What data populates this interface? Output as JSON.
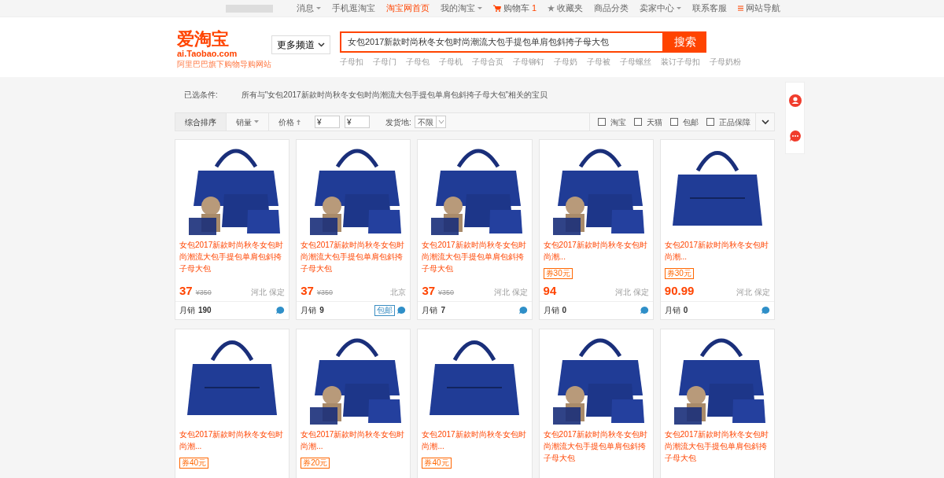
{
  "top_nav": {
    "items": [
      {
        "label": "消息",
        "kind": "dropdown"
      },
      {
        "label": "手机逛淘宝",
        "kind": "plain"
      },
      {
        "label": "淘宝网首页",
        "kind": "highlight"
      },
      {
        "label": "我的淘宝",
        "kind": "dropdown"
      },
      {
        "label": "购物车",
        "kind": "cart",
        "count": "1"
      },
      {
        "label": "收藏夹",
        "kind": "star"
      },
      {
        "label": "商品分类",
        "kind": "plain"
      },
      {
        "label": "卖家中心",
        "kind": "dropdown"
      },
      {
        "label": "联系客服",
        "kind": "plain"
      },
      {
        "label": "网站导航",
        "kind": "menu"
      }
    ]
  },
  "logo": {
    "title": "爱淘宝",
    "domain": "ai.Taobao.com",
    "tagline": "阿里巴巴旗下购物导购网站"
  },
  "channel_button": "更多频道",
  "search": {
    "value": "女包2017新款时尚秋冬女包时尚潮流大包手提包单肩包斜挎子母大包",
    "button": "搜索"
  },
  "suggestions": [
    "子母扣",
    "子母门",
    "子母包",
    "子母机",
    "子母合页",
    "子母铆钉",
    "子母奶",
    "子母被",
    "子母螺丝",
    "装订子母扣",
    "子母奶粉"
  ],
  "conditions": {
    "label": "已选条件:",
    "text": "所有与\"女包2017新款时尚秋冬女包时尚潮流大包手提包单肩包斜挎子母大包\"相关的宝贝"
  },
  "sort_tabs": [
    {
      "label": "综合排序",
      "selected": true
    },
    {
      "label": "销量",
      "selected": false
    },
    {
      "label": "价格",
      "selected": false
    }
  ],
  "price_from": {
    "placeholder": "¥"
  },
  "price_to": {
    "placeholder": "¥"
  },
  "ship_from": {
    "label": "发货地:",
    "value": "不限"
  },
  "filters": [
    {
      "label": "淘宝",
      "checked": false
    },
    {
      "label": "天猫",
      "checked": false
    },
    {
      "label": "包邮",
      "checked": false
    },
    {
      "label": "正品保障",
      "checked": false
    }
  ],
  "products": [
    {
      "kind": "set",
      "title": "女包2017新款时尚秋冬女包时尚潮流大包手提包单肩包斜挎子母大包",
      "price": "37",
      "original_price": "¥350",
      "location": "河北 保定",
      "sales_label": "月销",
      "sales": "190"
    },
    {
      "kind": "set",
      "title": "女包2017新款时尚秋冬女包时尚潮流大包手提包单肩包斜挎子母大包",
      "price": "37",
      "original_price": "¥350",
      "location": "北京",
      "sales_label": "月销",
      "sales": "9",
      "tag": "包邮"
    },
    {
      "kind": "set",
      "title": "女包2017新款时尚秋冬女包时尚潮流大包手提包单肩包斜挎子母大包",
      "price": "37",
      "original_price": "¥350",
      "location": "河北 保定",
      "sales_label": "月销",
      "sales": "7"
    },
    {
      "kind": "set",
      "title": "女包2017新款时尚秋冬女包时尚潮...",
      "coupon": "券30元",
      "price": "94",
      "location": "河北 保定",
      "sales_label": "月销",
      "sales": "0"
    },
    {
      "kind": "single",
      "title": "女包2017新款时尚秋冬女包时尚潮...",
      "coupon": "券30元",
      "price": "90.99",
      "location": "河北 保定",
      "sales_label": "月销",
      "sales": "0"
    },
    {
      "kind": "single",
      "title": "女包2017新款时尚秋冬女包时尚潮...",
      "coupon": "券40元"
    },
    {
      "kind": "set",
      "title": "女包2017新款时尚秋冬女包时尚潮...",
      "coupon": "券20元"
    },
    {
      "kind": "single",
      "title": "女包2017新款时尚秋冬女包时尚潮...",
      "coupon": "券40元"
    },
    {
      "kind": "set",
      "title": "女包2017新款时尚秋冬女包时尚潮流大包手提包单肩包斜挎子母大包"
    },
    {
      "kind": "set",
      "title": "女包2017新款时尚秋冬女包时尚潮流大包手提包单肩包斜挎子母大包"
    }
  ]
}
